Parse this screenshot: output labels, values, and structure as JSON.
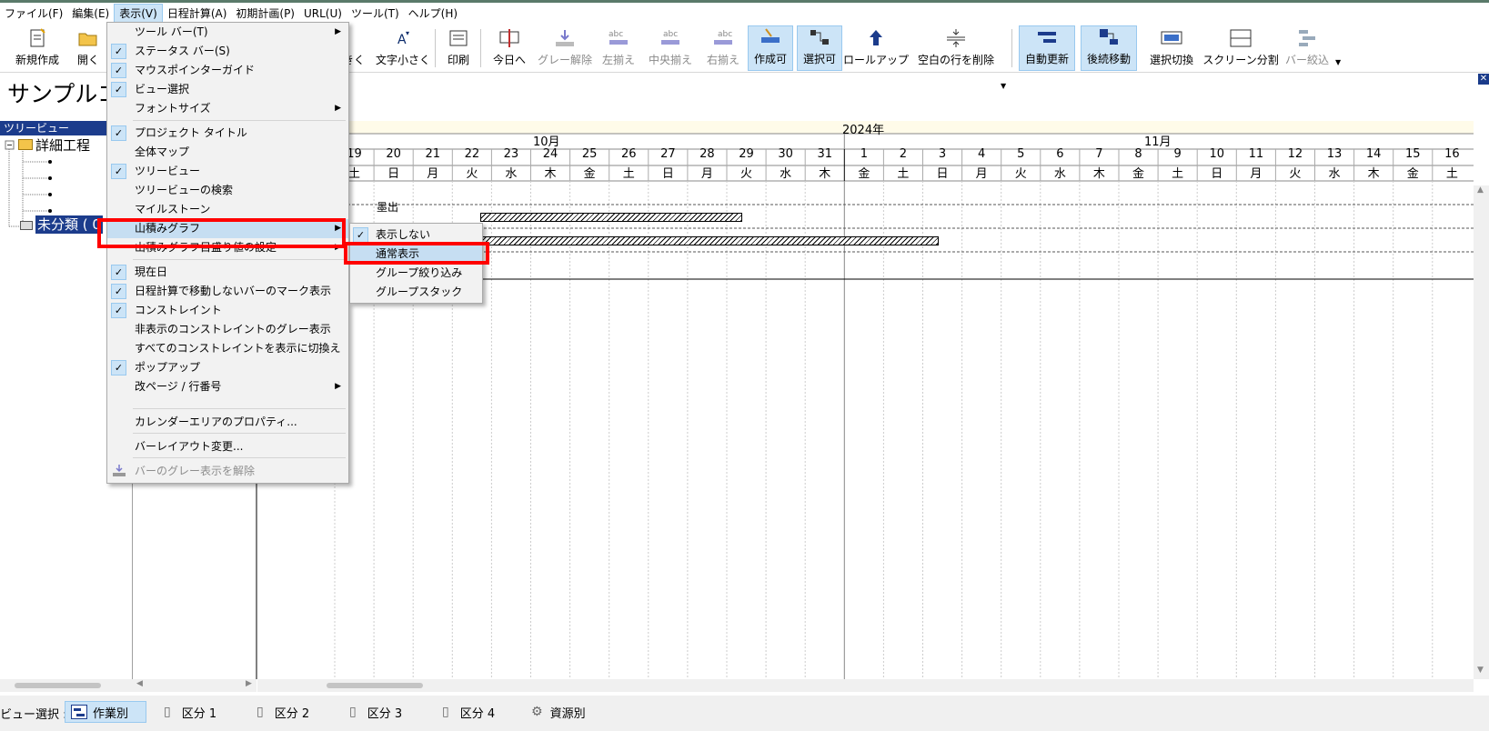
{
  "menubar": [
    "ファイル(F)",
    "編集(E)",
    "表示(V)",
    "日程計算(A)",
    "初期計画(P)",
    "URL(U)",
    "ツール(T)",
    "ヘルプ(H)"
  ],
  "toolbar": {
    "new": "新規作成",
    "open": "開く",
    "font_larger_partial": "きく",
    "font_smaller": "文字小さく",
    "print": "印刷",
    "today": "今日へ",
    "ungray": "グレー解除",
    "align_left": "左揃え",
    "align_center": "中央揃え",
    "align_right": "右揃え",
    "creatable": "作成可",
    "selectable": "選択可",
    "rollup": "ロールアップ",
    "delete_blank": "空白の行を削除",
    "auto_update": "自動更新",
    "follow_move": "後続移動",
    "select_switch": "選択切換",
    "screen_split": "スクリーン分割",
    "bar_filter": "バー絞込"
  },
  "project_title_partial": "サンプルコ",
  "tree": {
    "header": "ツリービュー",
    "root": "詳細工程",
    "unclassified": "未分類 ( 0"
  },
  "gantt": {
    "year": "2024年",
    "month_oct": "10月",
    "month_nov": "11月",
    "days": [
      "19",
      "20",
      "21",
      "22",
      "23",
      "24",
      "25",
      "26",
      "27",
      "28",
      "29",
      "30",
      "31",
      "1",
      "2",
      "3",
      "4",
      "5",
      "6",
      "7",
      "8",
      "9",
      "10",
      "11",
      "12",
      "13",
      "14",
      "15",
      "16"
    ],
    "weekdays": [
      "土",
      "日",
      "月",
      "火",
      "水",
      "木",
      "金",
      "土",
      "日",
      "月",
      "火",
      "水",
      "木",
      "金",
      "土",
      "日",
      "月",
      "火",
      "水",
      "木",
      "金",
      "土",
      "日",
      "月",
      "火",
      "水",
      "木",
      "金",
      "土"
    ],
    "task_label": "墨出"
  },
  "view_menu": {
    "toolbar": "ツール バー(T)",
    "statusbar": "ステータス バー(S)",
    "mouse_guide": "マウスポインターガイド",
    "view_select": "ビュー選択",
    "font_size": "フォントサイズ",
    "project_title": "プロジェクト タイトル",
    "whole_map": "全体マップ",
    "tree_view": "ツリービュー",
    "tree_search": "ツリービューの検索",
    "milestone": "マイルストーン",
    "yamazumi": "山積みグラフ",
    "yamazumi_scale": "山積みグラフ目盛り値の設定",
    "today_line": "現在日",
    "nonmoving_mark": "日程計算で移動しないバーのマーク表示",
    "constraint": "コンストレイント",
    "hidden_constraint_gray": "非表示のコンストレイントのグレー表示",
    "show_all_constraints": "すべてのコンストレイントを表示に切換え",
    "popup": "ポップアップ",
    "page_break": "改ページ / 行番号",
    "calendar_props": "カレンダーエリアのプロパティ...",
    "bar_layout": "バーレイアウト変更...",
    "ungray_bars": "バーのグレー表示を解除"
  },
  "yamazumi_submenu": {
    "hide": "表示しない",
    "normal": "通常表示",
    "group_filter": "グループ絞り込み",
    "group_stack": "グループスタック"
  },
  "statusbar": {
    "view_select_label": "ビュー選択 :",
    "tabs": [
      "作業別",
      "区分 1",
      "区分 2",
      "区分 3",
      "区分 4",
      "資源別"
    ]
  },
  "colors": {
    "highlight": "#cce4f7",
    "tree_header": "#1c3c8c",
    "red_box": "#ff0000",
    "header_band": "#fffbe9"
  }
}
